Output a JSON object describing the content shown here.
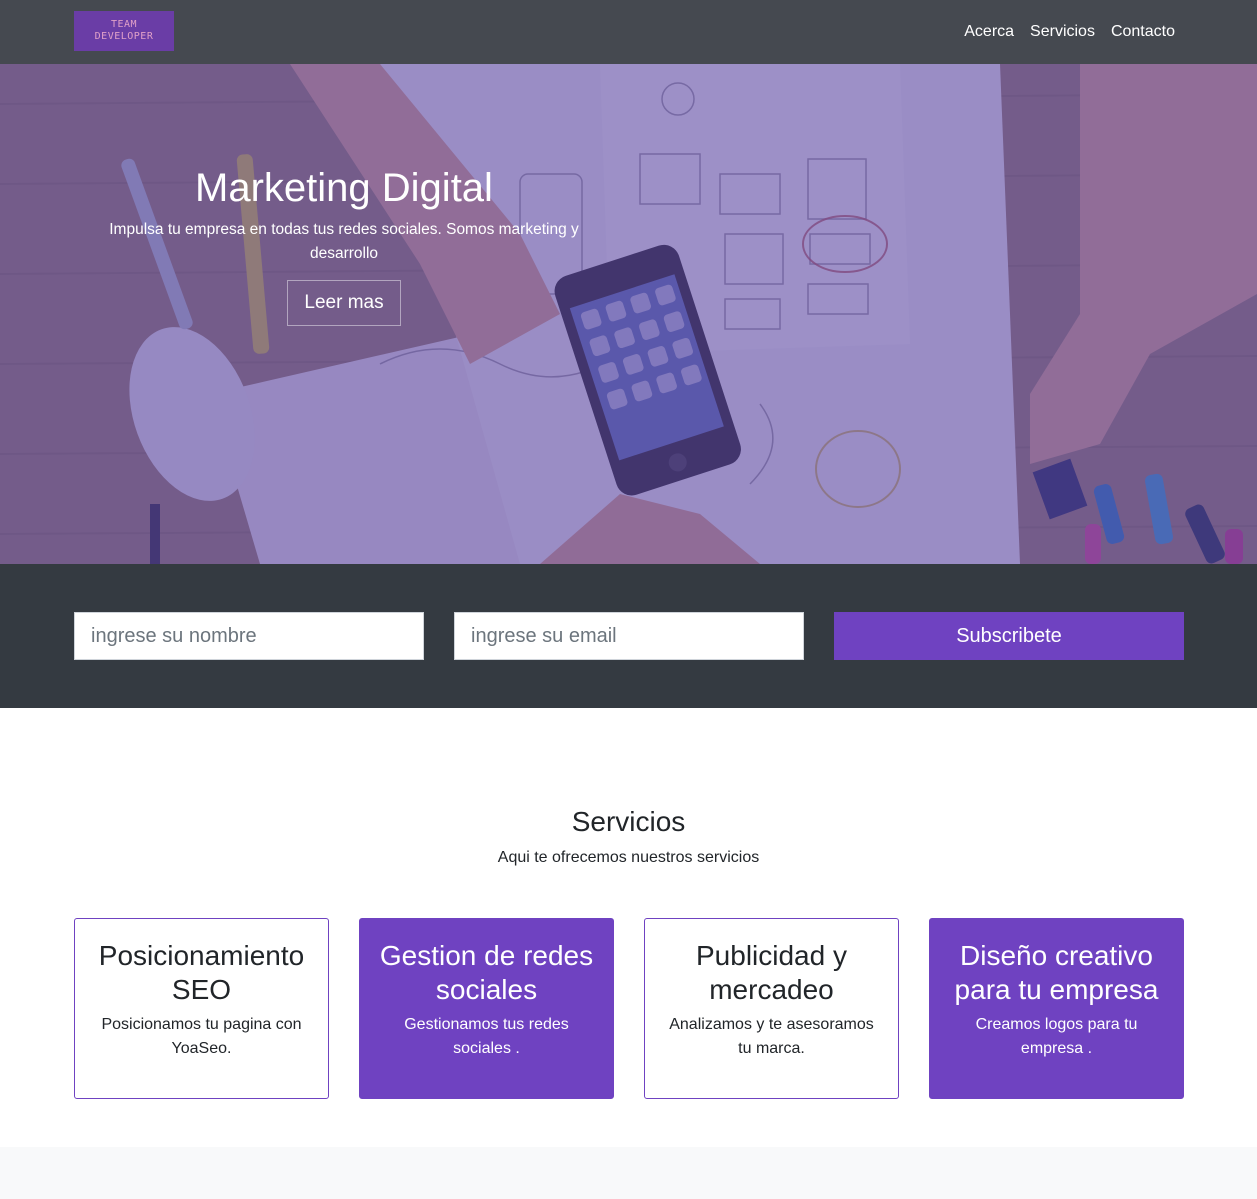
{
  "navbar": {
    "logo": {
      "line1": "TEAM",
      "line2": "DEVELOPER"
    },
    "links": [
      "Acerca",
      "Servicios",
      "Contacto"
    ]
  },
  "hero": {
    "title": "Marketing Digital",
    "subtitle": "Impulsa tu empresa en todas tus redes sociales. Somos marketing y desarrollo",
    "button": "Leer mas",
    "overlay_color": "#563ea0"
  },
  "subscribe": {
    "name_placeholder": "ingrese su nombre",
    "email_placeholder": "ingrese su email",
    "button": "Subscribete"
  },
  "services": {
    "title": "Servicios",
    "subtitle": "Aqui te ofrecemos nuestros servicios",
    "cards": [
      {
        "title": "Posicionamiento SEO",
        "text": "Posicionamos tu pagina con YoaSeo."
      },
      {
        "title": "Gestion de redes sociales",
        "text": "Gestionamos tus redes sociales ."
      },
      {
        "title": "Publicidad y mercadeo",
        "text": "Analizamos y te asesoramos tu marca."
      },
      {
        "title": "Diseño creativo para tu empresa",
        "text": "Creamos logos para tu empresa ."
      }
    ]
  },
  "colors": {
    "navbar": "#454950",
    "subscribe_band": "#343a41",
    "accent": "#6f42c1"
  }
}
